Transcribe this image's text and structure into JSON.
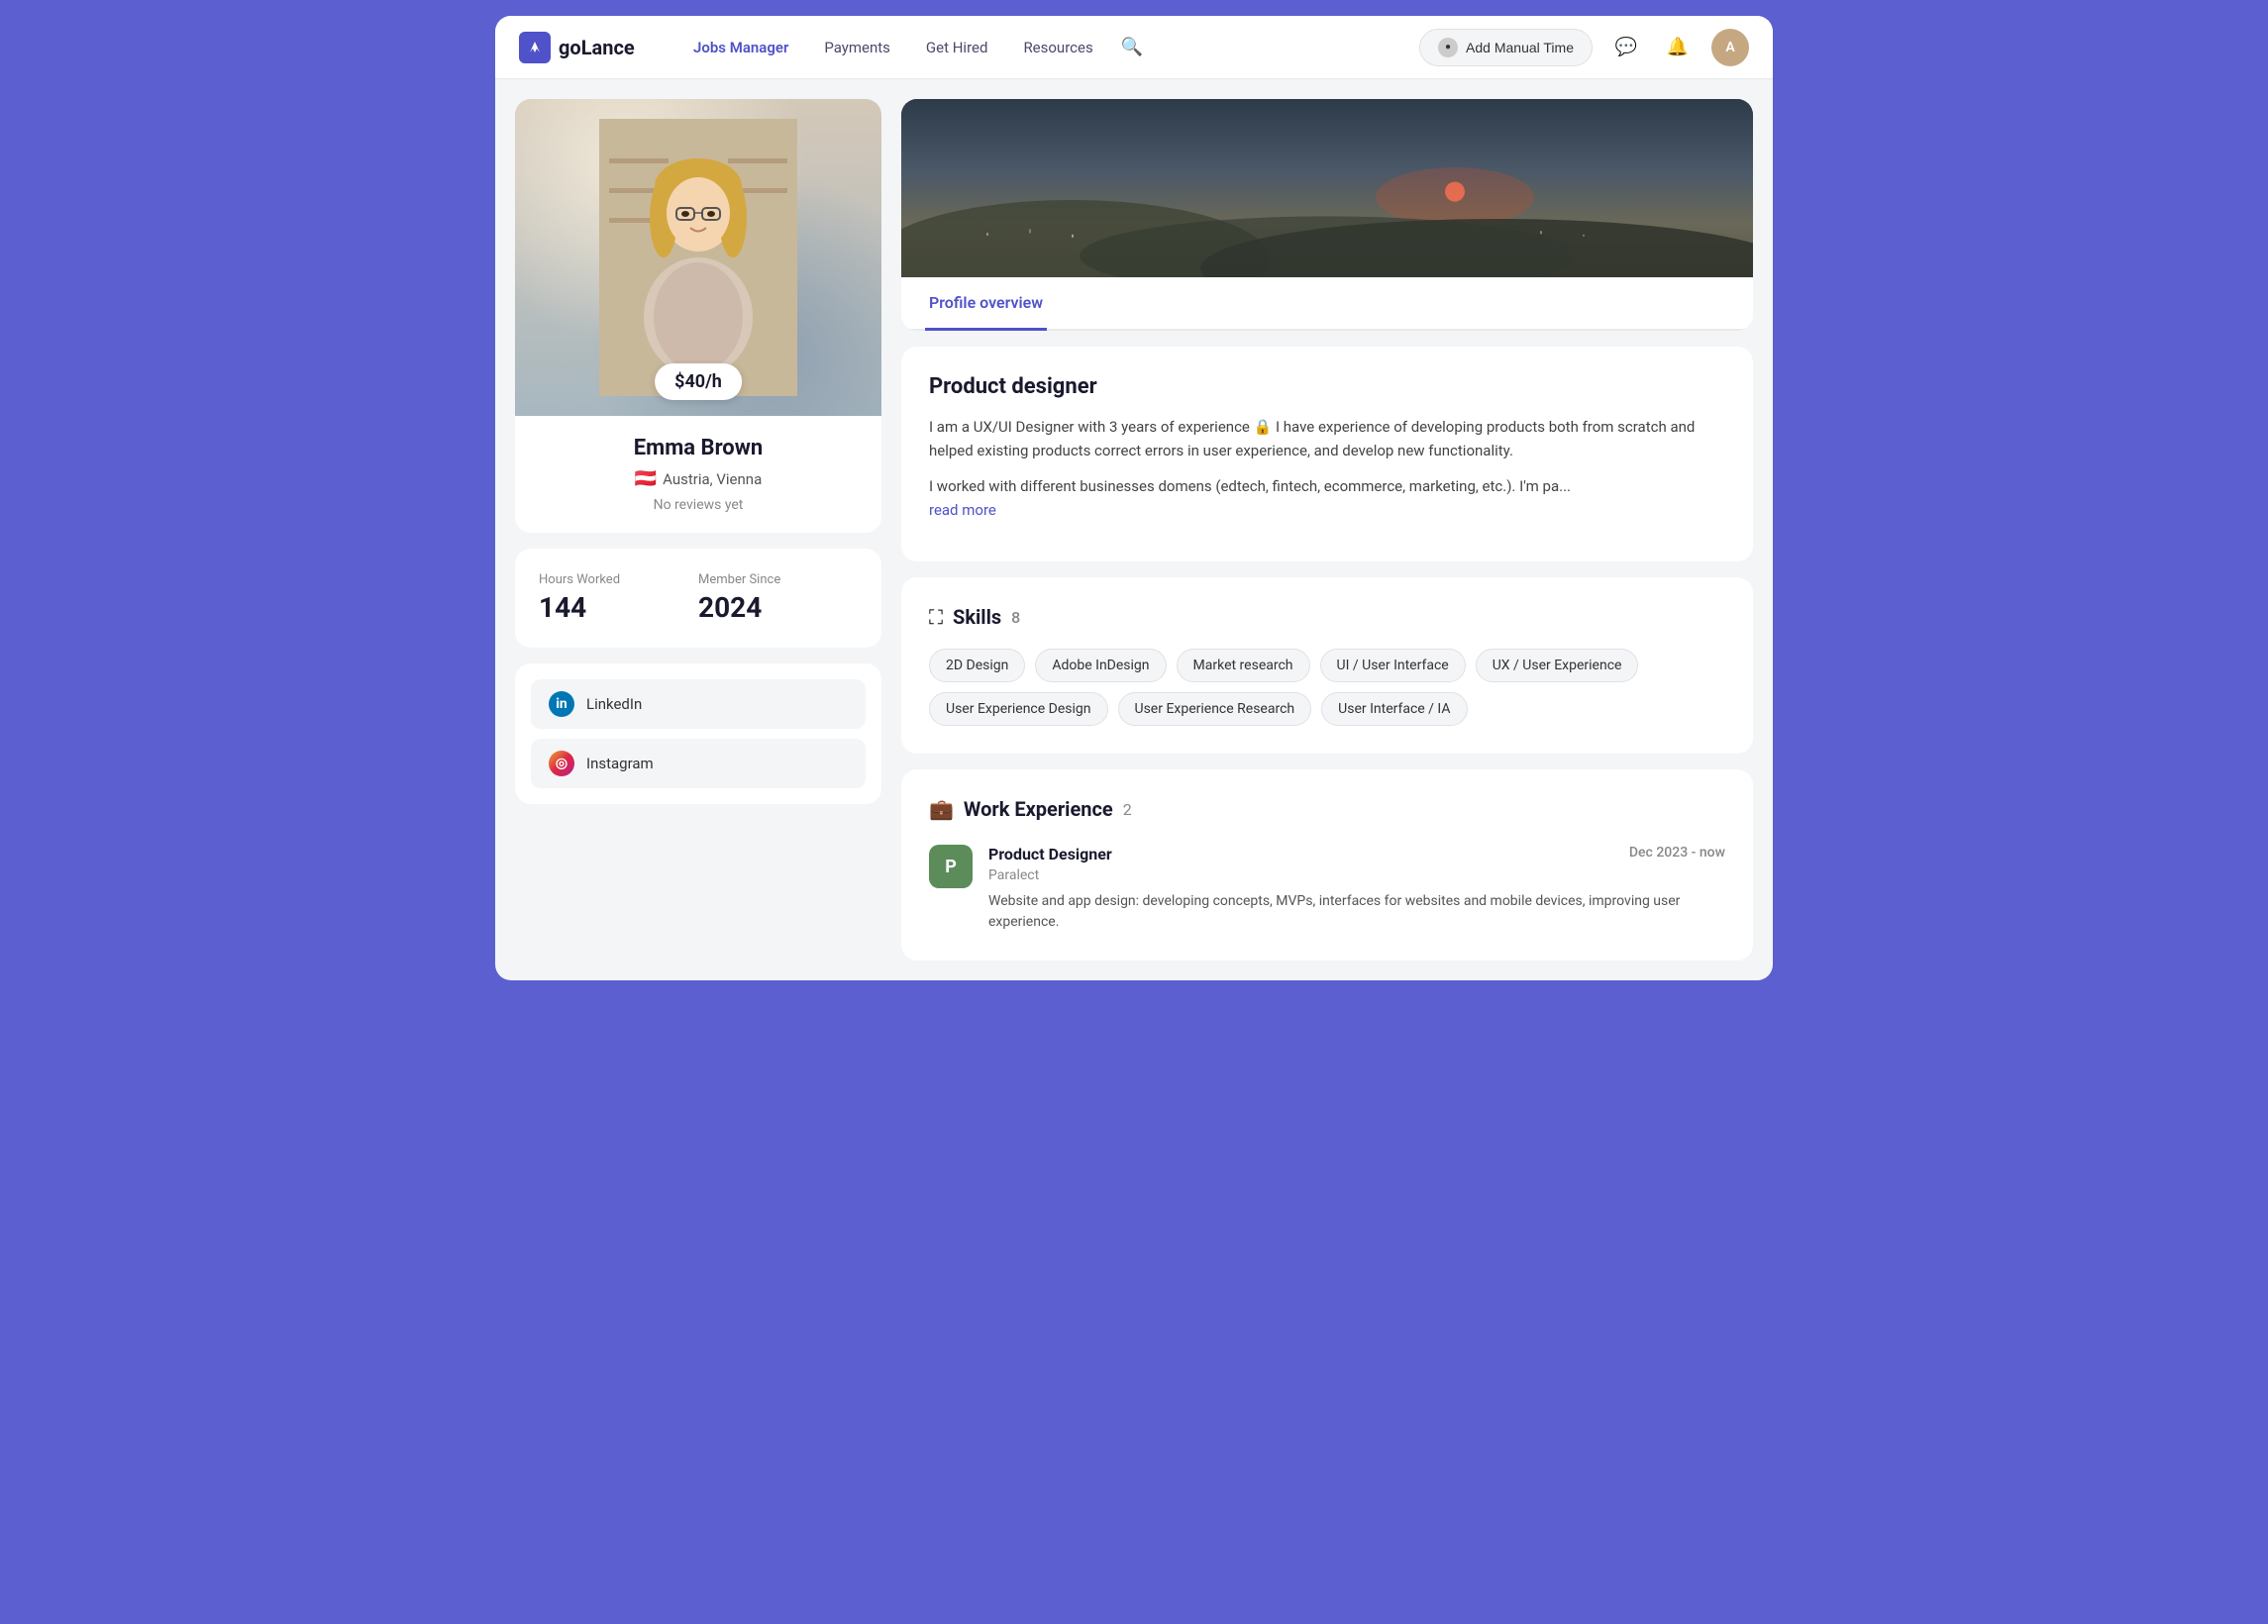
{
  "header": {
    "logo_text": "goLance",
    "nav_items": [
      "Jobs Manager",
      "Payments",
      "Get Hired",
      "Resources"
    ],
    "add_manual_btn": "Add Manual Time",
    "avatar_initials": "A"
  },
  "sidebar": {
    "rate": "$40/h",
    "name": "Emma Brown",
    "location": "Austria, Vienna",
    "reviews": "No reviews yet",
    "stats": {
      "hours_label": "Hours Worked",
      "hours_value": "144",
      "member_label": "Member Since",
      "member_value": "2024"
    },
    "social": [
      {
        "name": "LinkedIn",
        "icon_letter": "in",
        "type": "linkedin"
      },
      {
        "name": "Instagram",
        "icon_letter": "◎",
        "type": "instagram"
      }
    ]
  },
  "profile": {
    "tab_label": "Profile overview",
    "bio": {
      "title": "Product designer",
      "para1": "I am a UX/UI Designer with 3 years of experience 🔒 I have experience of developing products both from scratch and helped existing products correct errors in user experience, and develop new functionality.",
      "para2": "I worked with different businesses domens (edtech, fintech, ecommerce, marketing, etc.). I'm pa...",
      "read_more": "read more"
    },
    "skills": {
      "title": "Skills",
      "count": "8",
      "tags": [
        "2D Design",
        "Adobe InDesign",
        "Market research",
        "UI / User Interface",
        "UX / User Experience",
        "User Experience Design",
        "User Experience Research",
        "User Interface / IA"
      ]
    },
    "work_experience": {
      "title": "Work Experience",
      "count": "2",
      "items": [
        {
          "logo_letter": "P",
          "role": "Product Designer",
          "company": "Paralect",
          "date": "Dec 2023 - now",
          "description": "Website and app design: developing concepts, MVPs, interfaces for websites and mobile devices, improving user experience."
        }
      ]
    }
  }
}
